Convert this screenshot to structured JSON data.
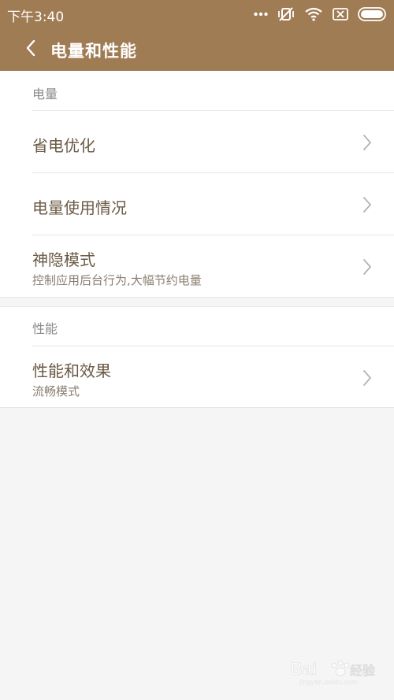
{
  "status_bar": {
    "time": "下午3:40",
    "icons": [
      "more-dots-icon",
      "vibrate-off-icon",
      "wifi-icon",
      "sim-off-icon",
      "battery-icon"
    ]
  },
  "header": {
    "title": "电量和性能",
    "back_icon": "chevron-left-icon",
    "background_color": "#a07c54"
  },
  "sections": [
    {
      "header": "电量",
      "items": [
        {
          "title": "省电优化",
          "subtitle": ""
        },
        {
          "title": "电量使用情况",
          "subtitle": ""
        },
        {
          "title": "神隐模式",
          "subtitle": "控制应用后台行为,大幅节约电量"
        }
      ]
    },
    {
      "header": "性能",
      "items": [
        {
          "title": "性能和效果",
          "subtitle": "流畅模式"
        }
      ]
    }
  ],
  "watermark": {
    "text": "Bai",
    "text_cn": "经验",
    "sub": "jingyan.baidu.com"
  }
}
